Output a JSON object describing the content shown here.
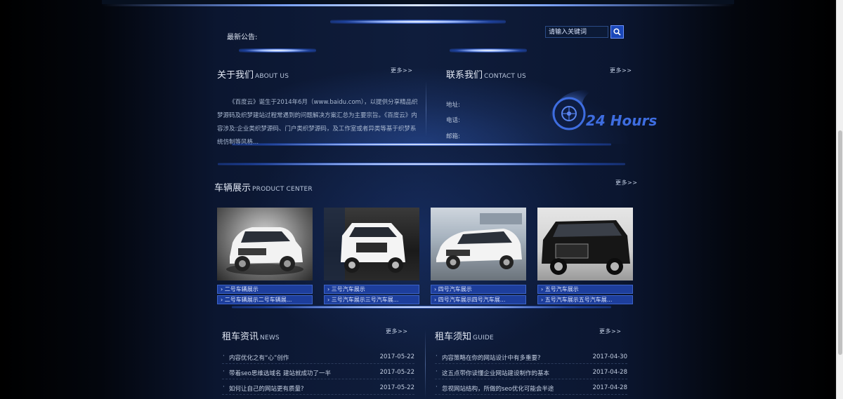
{
  "notice": {
    "label": "最新公告:"
  },
  "search": {
    "placeholder": "请输入关键词"
  },
  "about": {
    "title": "关于我们",
    "title_en": "ABOUT US",
    "more": "更多>>",
    "text": "《百度云》诞生于2014年6月（www.baidu.com），以提供分享精品织梦源码及织梦建站过程常遇到的问题解决方案汇总为主要宗旨。《百度云》内容涉及:企业类织梦源码、门户类织梦源码，及工作室或者异类等基于织梦系统仿制等风格..."
  },
  "contact": {
    "title": "联系我们",
    "title_en": "CONTACT US",
    "more": "更多>>",
    "address_label": "地址:",
    "phone_label": "电话:",
    "email_label": "邮箱:",
    "logo_text": "24 Hours"
  },
  "products": {
    "title": "车辆展示",
    "title_en": "PRODUCT CENTER",
    "more": "更多>>",
    "items": [
      {
        "name": "› 二号车辆展示",
        "desc": "› 二号车辆展示二号车辆展..."
      },
      {
        "name": "› 三号汽车展示",
        "desc": "› 三号汽车展示三号汽车展..."
      },
      {
        "name": "› 四号汽车展示",
        "desc": "› 四号汽车展示四号汽车展..."
      },
      {
        "name": "› 五号汽车展示",
        "desc": "› 五号汽车展示五号汽车展..."
      }
    ]
  },
  "news": {
    "title": "租车资讯",
    "title_en": "NEWS",
    "more": "更多>>",
    "items": [
      {
        "title": "内容优化之有“心”创作",
        "date": "2017-05-22"
      },
      {
        "title": "带着seo思维选域名 建站就成功了一半",
        "date": "2017-05-22"
      },
      {
        "title": "如何让自己的网站更有质量?",
        "date": "2017-05-22"
      }
    ]
  },
  "guide": {
    "title": "租车须知",
    "title_en": "GUIDE",
    "more": "更多>>",
    "items": [
      {
        "title": "内容策略在你的网站设计中有多重要?",
        "date": "2017-04-30"
      },
      {
        "title": "这五点带你读懂企业网站建设制作的基本",
        "date": "2017-04-28"
      },
      {
        "title": "忽视网站结构，所做的seo优化可能会半途",
        "date": "2017-04-28"
      }
    ]
  },
  "colors": {
    "accent": "#1d3e9c",
    "background": "#0f1d3c"
  }
}
